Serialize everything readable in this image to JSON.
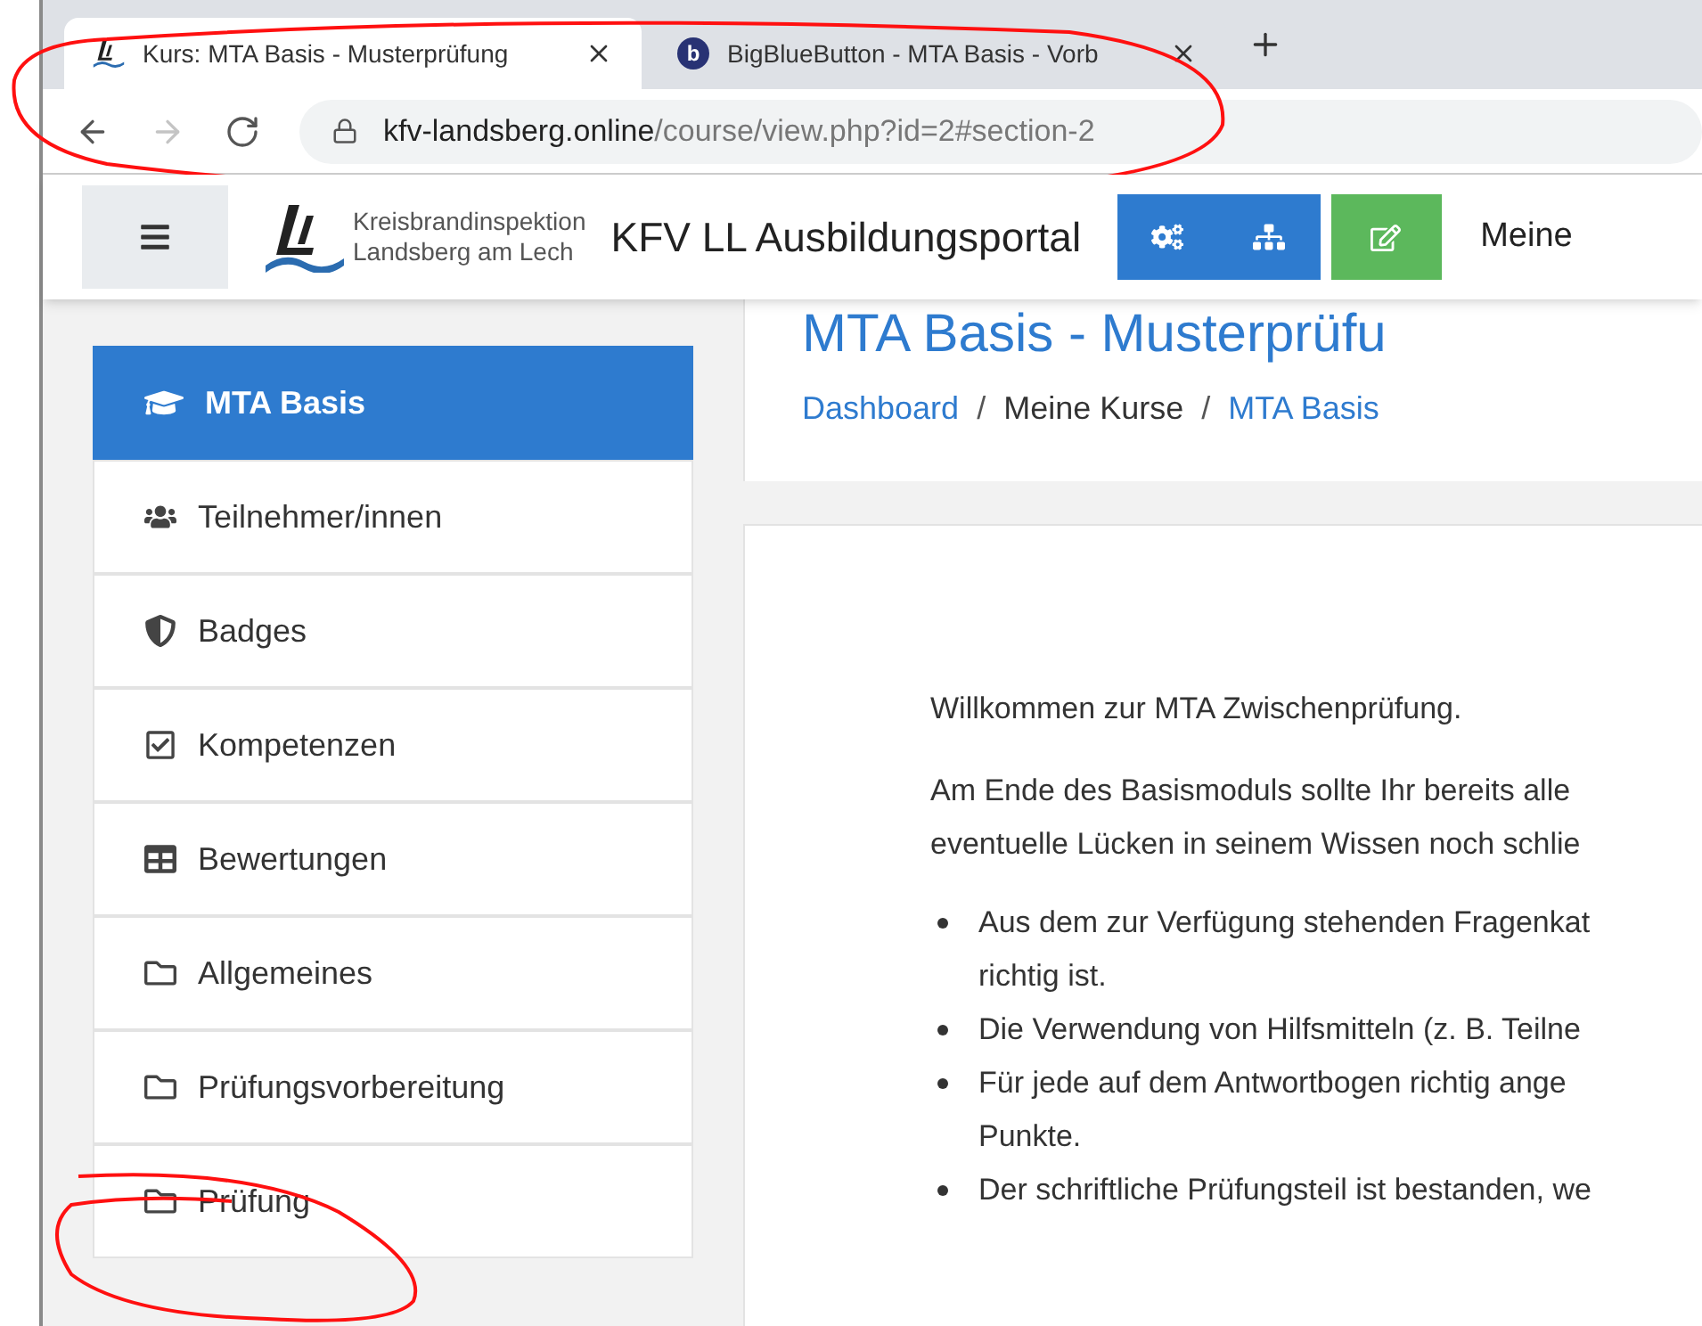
{
  "browser": {
    "tabs": [
      {
        "kind": "logo",
        "title": "Kurs: MTA Basis - Musterprüfung",
        "selected": true
      },
      {
        "kind": "letter",
        "letter": "b",
        "title": "BigBlueButton - MTA Basis - Vorb",
        "selected": false
      }
    ],
    "url": {
      "host": "kfv-landsberg.online",
      "path": "/course/view.php?id=2#section-2"
    },
    "nav": [
      {
        "kind": "back",
        "disabled": false
      },
      {
        "kind": "forward",
        "disabled": true
      },
      {
        "kind": "reload",
        "disabled": false
      }
    ]
  },
  "header": {
    "logo_lines": [
      "Kreisbrandinspektion",
      "Landsberg am Lech"
    ],
    "site_name": "KFV LL Ausbildungsportal",
    "user_menu": "Meine"
  },
  "sidebar": {
    "items": [
      {
        "kind": "course",
        "label": "MTA Basis",
        "selected": true
      },
      {
        "kind": "participants",
        "label": "Teilnehmer/innen",
        "selected": false
      },
      {
        "kind": "badges",
        "label": "Badges",
        "selected": false
      },
      {
        "kind": "competencies",
        "label": "Kompetenzen",
        "selected": false
      },
      {
        "kind": "grades",
        "label": "Bewertungen",
        "selected": false
      },
      {
        "kind": "section",
        "label": "Allgemeines",
        "selected": false
      },
      {
        "kind": "section",
        "label": "Prüfungsvorbereitung",
        "selected": false
      },
      {
        "kind": "section",
        "label": "Prüfung",
        "selected": false
      }
    ]
  },
  "page": {
    "heading": "MTA Basis - Musterprüfu",
    "breadcrumb_separator": "/",
    "breadcrumb": [
      {
        "label": "Dashboard",
        "link": true
      },
      {
        "label": "Meine Kurse",
        "link": false
      },
      {
        "label": "MTA Basis",
        "link": true
      }
    ],
    "intro": "Willkommen zur MTA Zwischenprüfung.",
    "paragraph": [
      "Am Ende des Basismoduls sollte Ihr bereits alle",
      "eventuelle Lücken in seinem Wissen noch schlie"
    ],
    "bullets": [
      [
        "Aus dem zur Verfügung stehenden Fragenkat",
        "richtig ist."
      ],
      [
        "Die Verwendung von Hilfsmitteln (z. B. Teilne"
      ],
      [
        "Für jede auf dem Antwortbogen richtig ange",
        "Punkte."
      ],
      [
        "Der schriftliche Prüfungsteil ist bestanden, we"
      ]
    ]
  }
}
